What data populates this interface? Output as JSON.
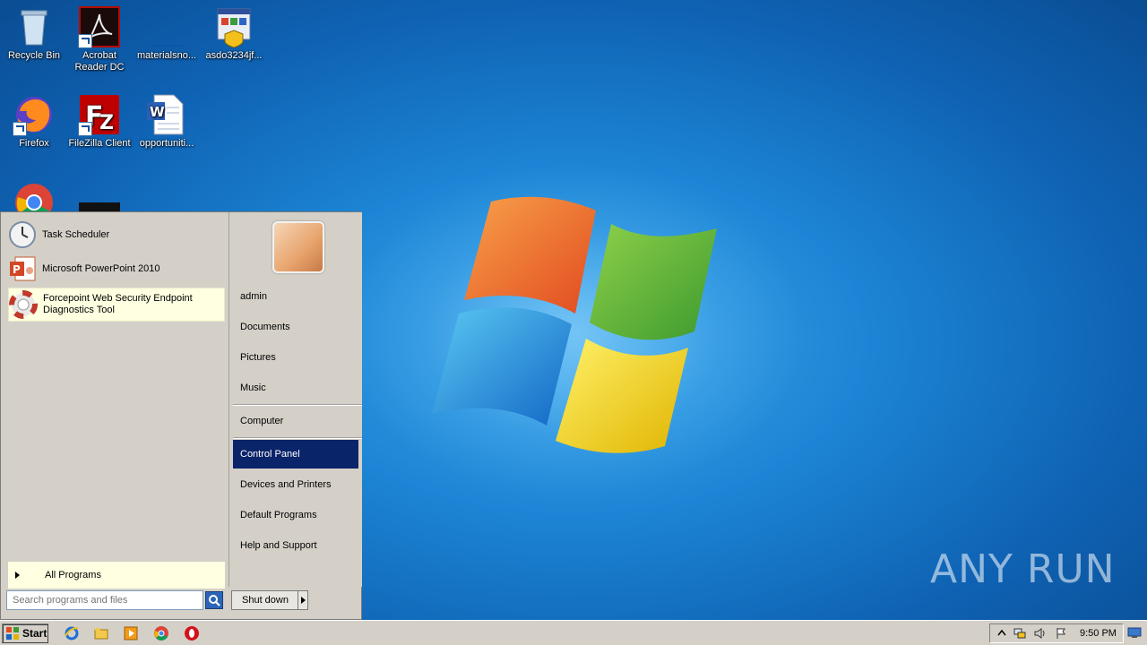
{
  "desktop": {
    "icons": [
      {
        "label": "Recycle Bin"
      },
      {
        "label": "Acrobat Reader DC"
      },
      {
        "label": "materialsno..."
      },
      {
        "label": "asdo3234jf..."
      },
      {
        "label": "Firefox"
      },
      {
        "label": "FileZilla Client"
      },
      {
        "label": "opportuniti..."
      }
    ],
    "watermark": "ANY RUN"
  },
  "start_menu": {
    "programs": [
      {
        "label": "Task Scheduler",
        "icon": "clock-icon"
      },
      {
        "label": "Microsoft PowerPoint 2010",
        "icon": "powerpoint-icon"
      },
      {
        "label": "Forcepoint Web Security Endpoint Diagnostics Tool",
        "icon": "lifebuoy-icon",
        "highlighted": true
      }
    ],
    "all_programs": "All Programs",
    "search_placeholder": "Search programs and files",
    "right_links": [
      {
        "label": "admin"
      },
      {
        "label": "Documents"
      },
      {
        "label": "Pictures"
      },
      {
        "label": "Music"
      },
      {
        "label": "Computer"
      },
      {
        "label": "Control Panel",
        "active": true
      },
      {
        "label": "Devices and Printers"
      },
      {
        "label": "Default Programs"
      },
      {
        "label": "Help and Support"
      }
    ],
    "shutdown": "Shut down"
  },
  "taskbar": {
    "start_label": "Start",
    "pinned": [
      "ie-icon",
      "explorer-icon",
      "media-player-icon",
      "chrome-icon",
      "opera-icon"
    ],
    "clock": "9:50 PM"
  },
  "colors": {
    "highlight": "#0a246a",
    "tooltip_bg": "#ffffe1",
    "classic_gray": "#d4d0c8"
  }
}
